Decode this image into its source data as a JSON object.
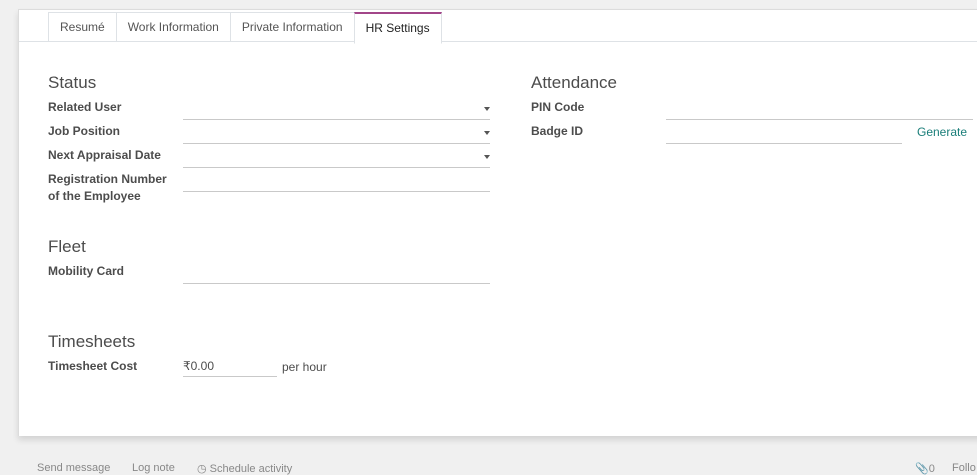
{
  "tabs": [
    {
      "label": "Resumé",
      "active": false
    },
    {
      "label": "Work Information",
      "active": false
    },
    {
      "label": "Private Information",
      "active": false
    },
    {
      "label": "HR Settings",
      "active": true
    }
  ],
  "status": {
    "title": "Status",
    "related_user": {
      "label": "Related User",
      "value": ""
    },
    "job_position": {
      "label": "Job Position",
      "value": ""
    },
    "next_appraisal_date": {
      "label": "Next Appraisal Date",
      "value": ""
    },
    "registration_number": {
      "label_line1": "Registration Number",
      "label_line2": "of the Employee",
      "value": ""
    }
  },
  "attendance": {
    "title": "Attendance",
    "pin_code": {
      "label": "PIN Code",
      "value": ""
    },
    "badge_id": {
      "label": "Badge ID",
      "value": ""
    },
    "generate_label": "Generate"
  },
  "fleet": {
    "title": "Fleet",
    "mobility_card": {
      "label": "Mobility Card",
      "value": ""
    }
  },
  "timesheets": {
    "title": "Timesheets",
    "cost_label": "Timesheet Cost",
    "cost_value": "₹0.00",
    "unit": "per hour"
  },
  "chatter": {
    "send_message": "Send message",
    "log_note": "Log note",
    "schedule_activity": "Schedule activity",
    "attachments": "0",
    "follow": "Follo"
  },
  "colors": {
    "accent_tab": "#a24689",
    "link": "#1a7e79"
  }
}
